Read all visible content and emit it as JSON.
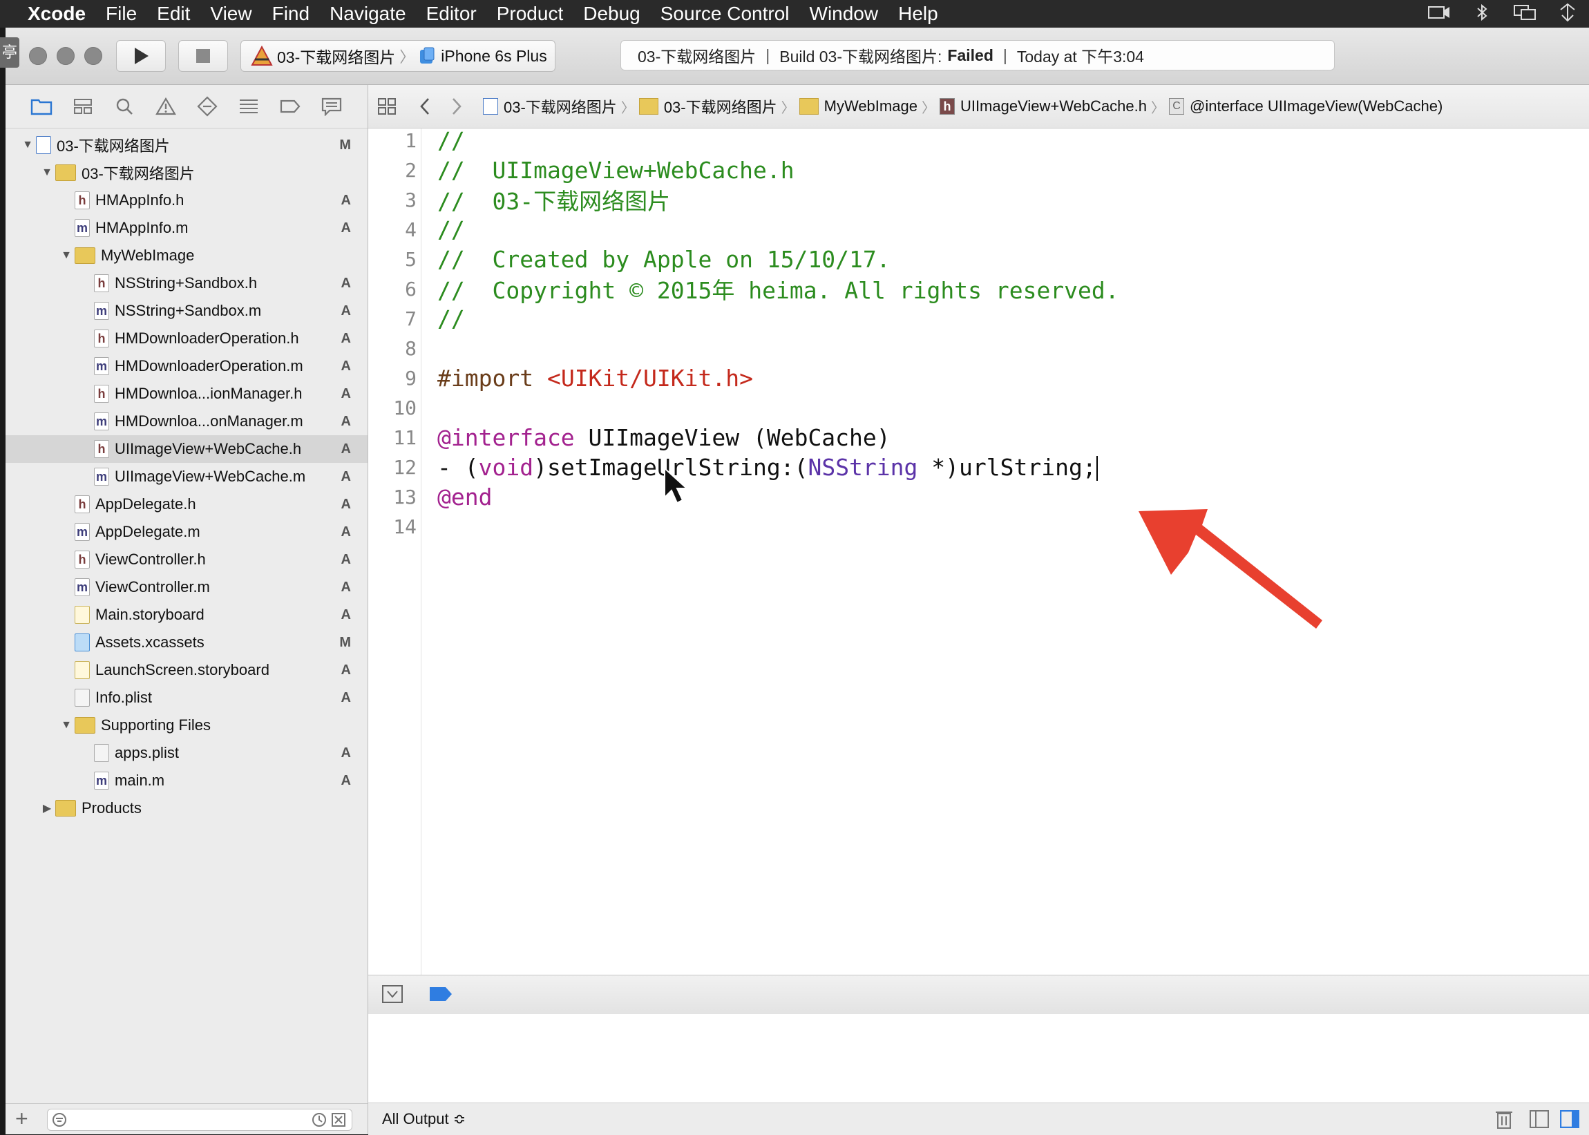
{
  "menubar": {
    "app": "Xcode",
    "items": [
      "File",
      "Edit",
      "View",
      "Find",
      "Navigate",
      "Editor",
      "Product",
      "Debug",
      "Source Control",
      "Window",
      "Help"
    ],
    "status_icons": [
      "screen-record-icon",
      "bluetooth-icon",
      "displays-icon",
      "network-icon"
    ]
  },
  "toolbar": {
    "stop_badge": "亭",
    "scheme": {
      "project": "03-下载网络图片",
      "device": "iPhone 6s Plus"
    },
    "activity": {
      "project": "03-下载网络图片",
      "build_prefix": "Build 03-下载网络图片:",
      "build_status": "Failed",
      "time": "Today at 下午3:04"
    }
  },
  "navigator": {
    "tabs": [
      "project-navigator-icon",
      "symbol-navigator-icon",
      "find-navigator-icon",
      "issue-navigator-icon",
      "test-navigator-icon",
      "debug-navigator-icon",
      "breakpoint-navigator-icon",
      "report-navigator-icon"
    ],
    "tree": [
      {
        "label": "03-下载网络图片",
        "icon": "project",
        "status": "M",
        "depth": 0,
        "expand": "open"
      },
      {
        "label": "03-下载网络图片",
        "icon": "folder",
        "status": "",
        "depth": 1,
        "expand": "open"
      },
      {
        "label": "HMAppInfo.h",
        "icon": "h",
        "status": "A",
        "depth": 2,
        "expand": ""
      },
      {
        "label": "HMAppInfo.m",
        "icon": "m",
        "status": "A",
        "depth": 2,
        "expand": ""
      },
      {
        "label": "MyWebImage",
        "icon": "folder",
        "status": "",
        "depth": 2,
        "expand": "open"
      },
      {
        "label": "NSString+Sandbox.h",
        "icon": "h",
        "status": "A",
        "depth": 3,
        "expand": ""
      },
      {
        "label": "NSString+Sandbox.m",
        "icon": "m",
        "status": "A",
        "depth": 3,
        "expand": ""
      },
      {
        "label": "HMDownloaderOperation.h",
        "icon": "h",
        "status": "A",
        "depth": 3,
        "expand": ""
      },
      {
        "label": "HMDownloaderOperation.m",
        "icon": "m",
        "status": "A",
        "depth": 3,
        "expand": ""
      },
      {
        "label": "HMDownloa...ionManager.h",
        "icon": "h",
        "status": "A",
        "depth": 3,
        "expand": ""
      },
      {
        "label": "HMDownloa...onManager.m",
        "icon": "m",
        "status": "A",
        "depth": 3,
        "expand": ""
      },
      {
        "label": "UIImageView+WebCache.h",
        "icon": "h",
        "status": "A",
        "depth": 3,
        "expand": "",
        "selected": true
      },
      {
        "label": "UIImageView+WebCache.m",
        "icon": "m",
        "status": "A",
        "depth": 3,
        "expand": ""
      },
      {
        "label": "AppDelegate.h",
        "icon": "h",
        "status": "A",
        "depth": 2,
        "expand": ""
      },
      {
        "label": "AppDelegate.m",
        "icon": "m",
        "status": "A",
        "depth": 2,
        "expand": ""
      },
      {
        "label": "ViewController.h",
        "icon": "h",
        "status": "A",
        "depth": 2,
        "expand": ""
      },
      {
        "label": "ViewController.m",
        "icon": "m",
        "status": "A",
        "depth": 2,
        "expand": ""
      },
      {
        "label": "Main.storyboard",
        "icon": "storyboard",
        "status": "A",
        "depth": 2,
        "expand": ""
      },
      {
        "label": "Assets.xcassets",
        "icon": "assets",
        "status": "M",
        "depth": 2,
        "expand": ""
      },
      {
        "label": "LaunchScreen.storyboard",
        "icon": "storyboard",
        "status": "A",
        "depth": 2,
        "expand": ""
      },
      {
        "label": "Info.plist",
        "icon": "plist",
        "status": "A",
        "depth": 2,
        "expand": ""
      },
      {
        "label": "Supporting Files",
        "icon": "folder",
        "status": "",
        "depth": 2,
        "expand": "open"
      },
      {
        "label": "apps.plist",
        "icon": "plist",
        "status": "A",
        "depth": 3,
        "expand": ""
      },
      {
        "label": "main.m",
        "icon": "m",
        "status": "A",
        "depth": 3,
        "expand": ""
      },
      {
        "label": "Products",
        "icon": "folder",
        "status": "",
        "depth": 1,
        "expand": "closed"
      }
    ]
  },
  "jumpbar": {
    "crumbs": [
      {
        "label": "03-下载网络图片",
        "icon": "project"
      },
      {
        "label": "03-下载网络图片",
        "icon": "folder"
      },
      {
        "label": "MyWebImage",
        "icon": "folder"
      },
      {
        "label": "UIImageView+WebCache.h",
        "icon": "h"
      },
      {
        "label": "@interface UIImageView(WebCache)",
        "icon": "class"
      }
    ]
  },
  "editor": {
    "lines": [
      {
        "n": "1",
        "tokens": [
          {
            "t": "//",
            "c": "comment"
          }
        ]
      },
      {
        "n": "2",
        "tokens": [
          {
            "t": "//  UIImageView+WebCache.h",
            "c": "comment"
          }
        ]
      },
      {
        "n": "3",
        "tokens": [
          {
            "t": "//  03-下载网络图片",
            "c": "comment"
          }
        ]
      },
      {
        "n": "4",
        "tokens": [
          {
            "t": "//",
            "c": "comment"
          }
        ]
      },
      {
        "n": "5",
        "tokens": [
          {
            "t": "//  Created by Apple on 15/10/17.",
            "c": "comment"
          }
        ]
      },
      {
        "n": "6",
        "tokens": [
          {
            "t": "//  Copyright © 2015年 heima. All rights reserved.",
            "c": "comment"
          }
        ]
      },
      {
        "n": "7",
        "tokens": [
          {
            "t": "//",
            "c": "comment"
          }
        ]
      },
      {
        "n": "8",
        "tokens": []
      },
      {
        "n": "9",
        "tokens": [
          {
            "t": "#import ",
            "c": "pre"
          },
          {
            "t": "<UIKit/UIKit.h>",
            "c": "str"
          }
        ]
      },
      {
        "n": "10",
        "tokens": []
      },
      {
        "n": "11",
        "tokens": [
          {
            "t": "@interface",
            "c": "kw"
          },
          {
            "t": " UIImageView (WebCache)",
            "c": "plain"
          }
        ]
      },
      {
        "n": "12",
        "tokens": [
          {
            "t": "- (",
            "c": "plain"
          },
          {
            "t": "void",
            "c": "kw"
          },
          {
            "t": ")setImageUrlString:(",
            "c": "plain"
          },
          {
            "t": "NSString",
            "c": "type"
          },
          {
            "t": " *)urlString;",
            "c": "plain"
          }
        ],
        "caret": true
      },
      {
        "n": "13",
        "tokens": [
          {
            "t": "@end",
            "c": "kw"
          }
        ]
      },
      {
        "n": "14",
        "tokens": []
      }
    ]
  },
  "debug": {
    "output_selector": "All Output ≎"
  },
  "colors": {
    "comment": "#2c8c1f",
    "keyword": "#a3228f",
    "string": "#c4291c",
    "annotation_arrow": "#e8402f"
  }
}
